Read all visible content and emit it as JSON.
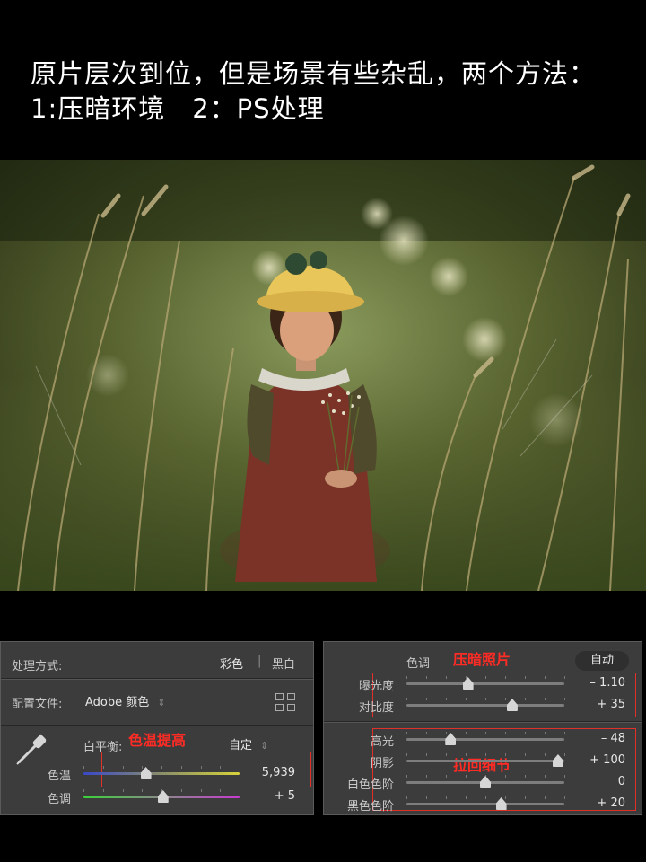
{
  "caption": {
    "line1": "原片层次到位，但是场景有些杂乱，两个方法：",
    "line2": "1:压暗环境　2：PS处理"
  },
  "left_panel": {
    "process_label": "处理方式:",
    "color_option": "彩色",
    "separator": "|",
    "bw_option": "黑白",
    "profile_label": "配置文件:",
    "profile_value": "Adobe 颜色",
    "profile_chevron": "⇕",
    "wb_label": "白平衡:",
    "wb_value": "自定",
    "wb_chevron": "⇕",
    "annotation": "色温提高",
    "sliders": [
      {
        "label": "色温",
        "value": "5,939",
        "position": 0.4
      },
      {
        "label": "色调",
        "value": "+ 5",
        "position": 0.51
      }
    ]
  },
  "right_panel": {
    "section_title": "色调",
    "auto_button": "自动",
    "annotation_top": "压暗照片",
    "annotation_bottom": "拉回细节",
    "sliders": [
      {
        "label": "曝光度",
        "value": "– 1.10",
        "position": 0.39
      },
      {
        "label": "对比度",
        "value": "+ 35",
        "position": 0.67
      },
      {
        "label": "高光",
        "value": "– 48",
        "position": 0.28
      },
      {
        "label": "阴影",
        "value": "+ 100",
        "position": 0.96
      },
      {
        "label": "白色色阶",
        "value": "0",
        "position": 0.5
      },
      {
        "label": "黑色色阶",
        "value": "+ 20",
        "position": 0.6
      }
    ]
  }
}
